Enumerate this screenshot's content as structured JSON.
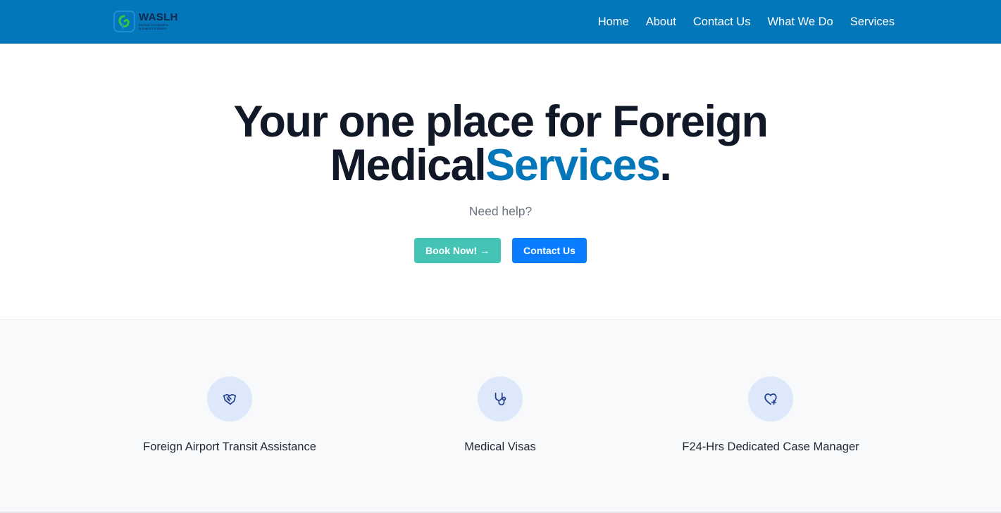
{
  "header": {
    "logo_name": "WASLH",
    "logo_tagline_1": "Medical Coordination",
    "logo_tagline_2": "& Support Solutions",
    "nav": [
      "Home",
      "About",
      "Contact Us",
      "What We Do",
      "Services"
    ]
  },
  "hero": {
    "title_line1": "Your one place for Foreign",
    "title_line2_main": "Medical",
    "title_line2_accent": "Services",
    "title_line2_end": ".",
    "subtitle": "Need help?",
    "book_button": "Book Now! →",
    "contact_button": "Contact Us"
  },
  "features": [
    {
      "label": "Foreign Airport Transit Assistance",
      "icon": "handshake-icon"
    },
    {
      "label": "Medical Visas",
      "icon": "stethoscope-icon"
    },
    {
      "label": "F24-Hrs Dedicated Case Manager",
      "icon": "heart-plus-icon"
    }
  ],
  "colors": {
    "navbar": "#0377b9",
    "accent": "#0377b9",
    "book_button": "#45c4b5",
    "contact_button": "#0a7cff",
    "icon_circle": "#dde9fb"
  }
}
